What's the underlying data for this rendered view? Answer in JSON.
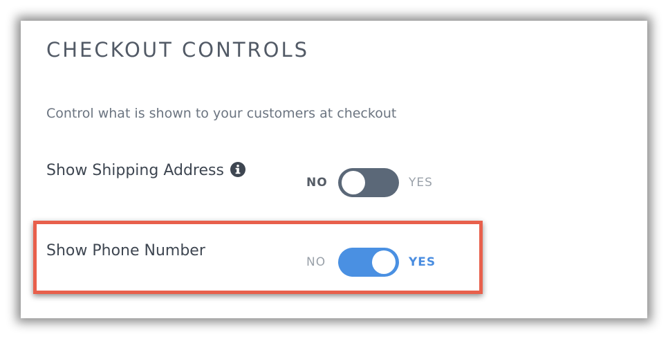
{
  "panel": {
    "title": "CHECKOUT CONTROLS",
    "subtitle": "Control what is shown to your customers at checkout"
  },
  "settings": [
    {
      "label": "Show Shipping Address",
      "has_info_icon": true,
      "info_icon": "info-circle-icon",
      "no_label": "NO",
      "yes_label": "YES",
      "enabled": false
    },
    {
      "label": "Show Phone Number",
      "has_info_icon": false,
      "no_label": "NO",
      "yes_label": "YES",
      "enabled": true
    }
  ],
  "colors": {
    "toggle_on": "#4a90e2",
    "toggle_off": "#5b6878",
    "highlight_border": "#e8604c"
  }
}
